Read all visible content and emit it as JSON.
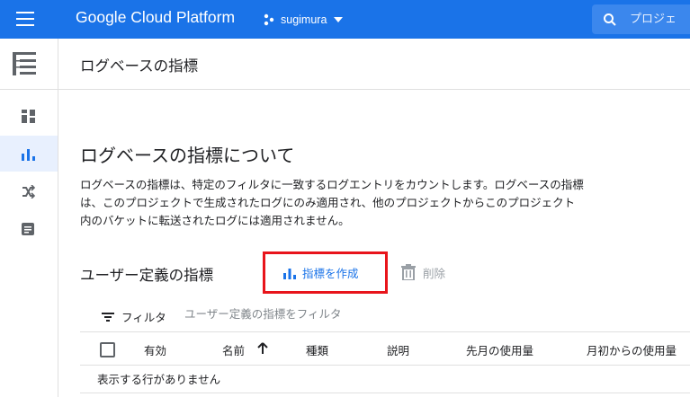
{
  "topbar": {
    "app_title": "Google Cloud Platform",
    "project_name": "sugimura",
    "search_placeholder": "プロジェ"
  },
  "page": {
    "title": "ログベースの指標"
  },
  "about": {
    "heading": "ログベースの指標について",
    "description": "ログベースの指標は、特定のフィルタに一致するログエントリをカウントします。ログベースの指標は、このプロジェクトで生成されたログにのみ適用され、他のプロジェクトからこのプロジェクト内のバケットに転送されたログには適用されません。"
  },
  "user_metrics": {
    "heading": "ユーザー定義の指標",
    "create_label": "指標を作成",
    "delete_label": "削除"
  },
  "filter": {
    "label": "フィルタ",
    "placeholder": "ユーザー定義の指標をフィルタ"
  },
  "table": {
    "columns": [
      "有効",
      "名前",
      "種類",
      "説明",
      "先月の使用量",
      "月初からの使用量"
    ],
    "empty_message": "表示する行がありません"
  },
  "colors": {
    "brand_blue": "#1a73e8",
    "highlight_red": "#e8141b"
  },
  "icons": {
    "menu": "hamburger-menu-icon",
    "project": "project-dots-icon",
    "search": "search-icon",
    "nav_header": "logs-nav-icon",
    "rail": [
      "dashboard-icon",
      "bar-chart-icon",
      "shuffle-icon",
      "document-icon"
    ],
    "create": "bar-chart-icon",
    "delete": "trash-icon",
    "filter": "filter-icon",
    "sort": "arrow-up-icon"
  }
}
